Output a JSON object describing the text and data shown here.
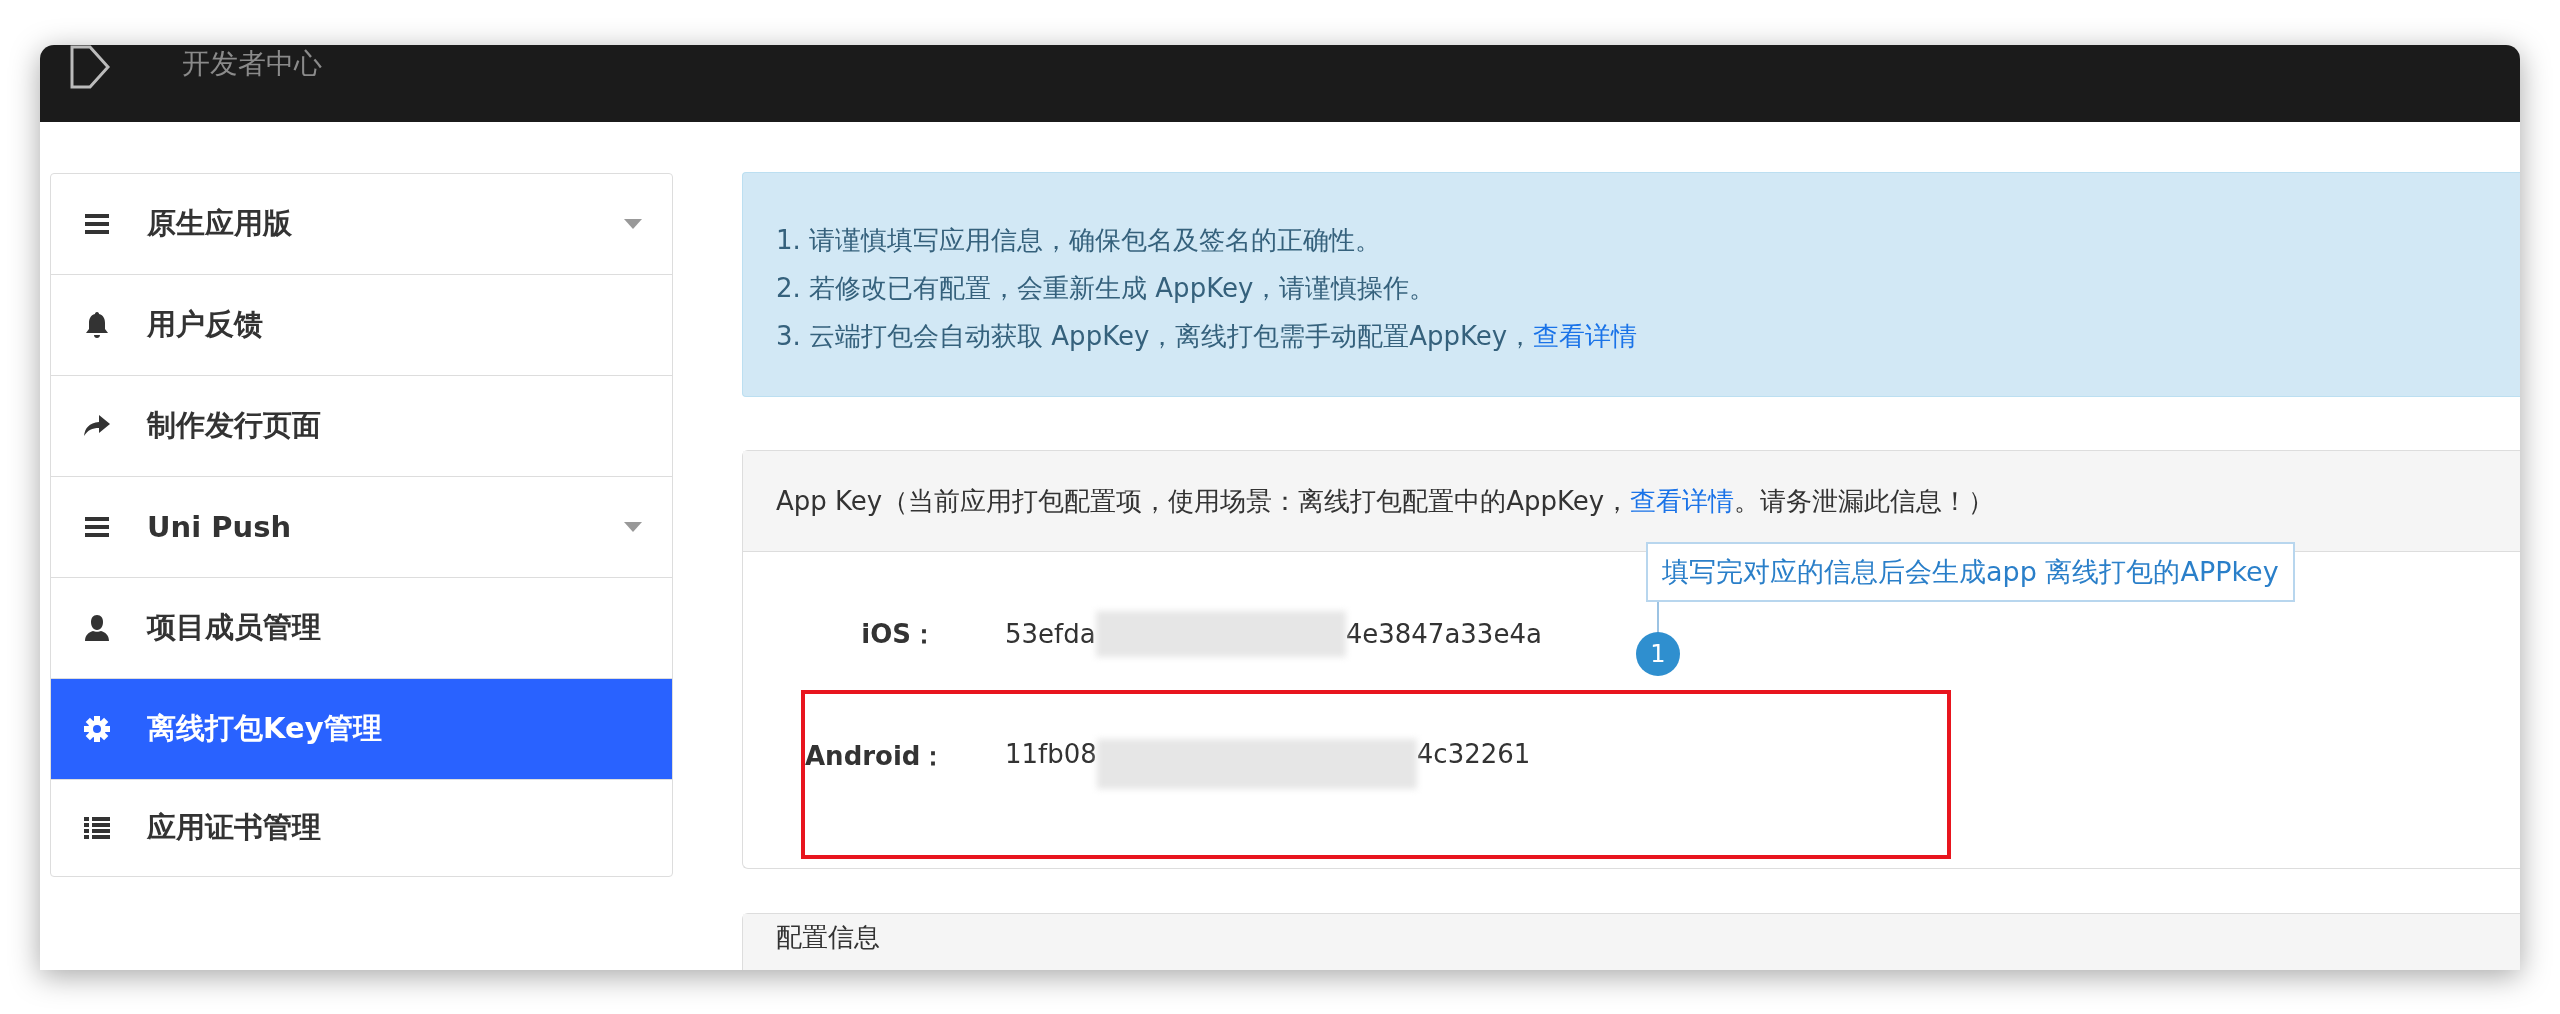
{
  "header": {
    "title": "开发者中心"
  },
  "sidebar": {
    "items": [
      {
        "label": "原生应用版",
        "kind": "group",
        "selected": false
      },
      {
        "label": "用户反馈",
        "kind": "link",
        "selected": false
      },
      {
        "label": "制作发行页面",
        "kind": "link",
        "selected": false
      },
      {
        "label": "Uni Push",
        "kind": "group",
        "selected": false
      },
      {
        "label": "项目成员管理",
        "kind": "link",
        "selected": false
      },
      {
        "label": "离线打包Key管理",
        "kind": "link",
        "selected": true
      },
      {
        "label": "应用证书管理",
        "kind": "link",
        "selected": false
      }
    ]
  },
  "notice": {
    "lines": [
      {
        "text": "1. 请谨慎填写应用信息，确保包名及签名的正确性。"
      },
      {
        "text": "2. 若修改已有配置，会重新生成 AppKey，请谨慎操作。"
      },
      {
        "text": "3. 云端打包会自动获取 AppKey，离线打包需手动配置AppKey，",
        "link": "查看详情"
      }
    ]
  },
  "app_key_panel": {
    "heading_before": "App Key（当前应用打包配置项，使用场景：离线打包配置中的AppKey，",
    "heading_link": "查看详情",
    "heading_after": "。请务泄漏此信息！）",
    "keys": [
      {
        "platform": "iOS：",
        "value_start": "53efda",
        "value_end": "4e3847a33e4a",
        "highlighted": false
      },
      {
        "platform": "Android：",
        "value_start": "11fb08",
        "value_end": "4c32261",
        "highlighted": true
      }
    ],
    "annotation": {
      "number": "1",
      "text": "填写完对应的信息后会生成app 离线打包的APPkey"
    }
  },
  "config_panel": {
    "heading": "配置信息"
  }
}
